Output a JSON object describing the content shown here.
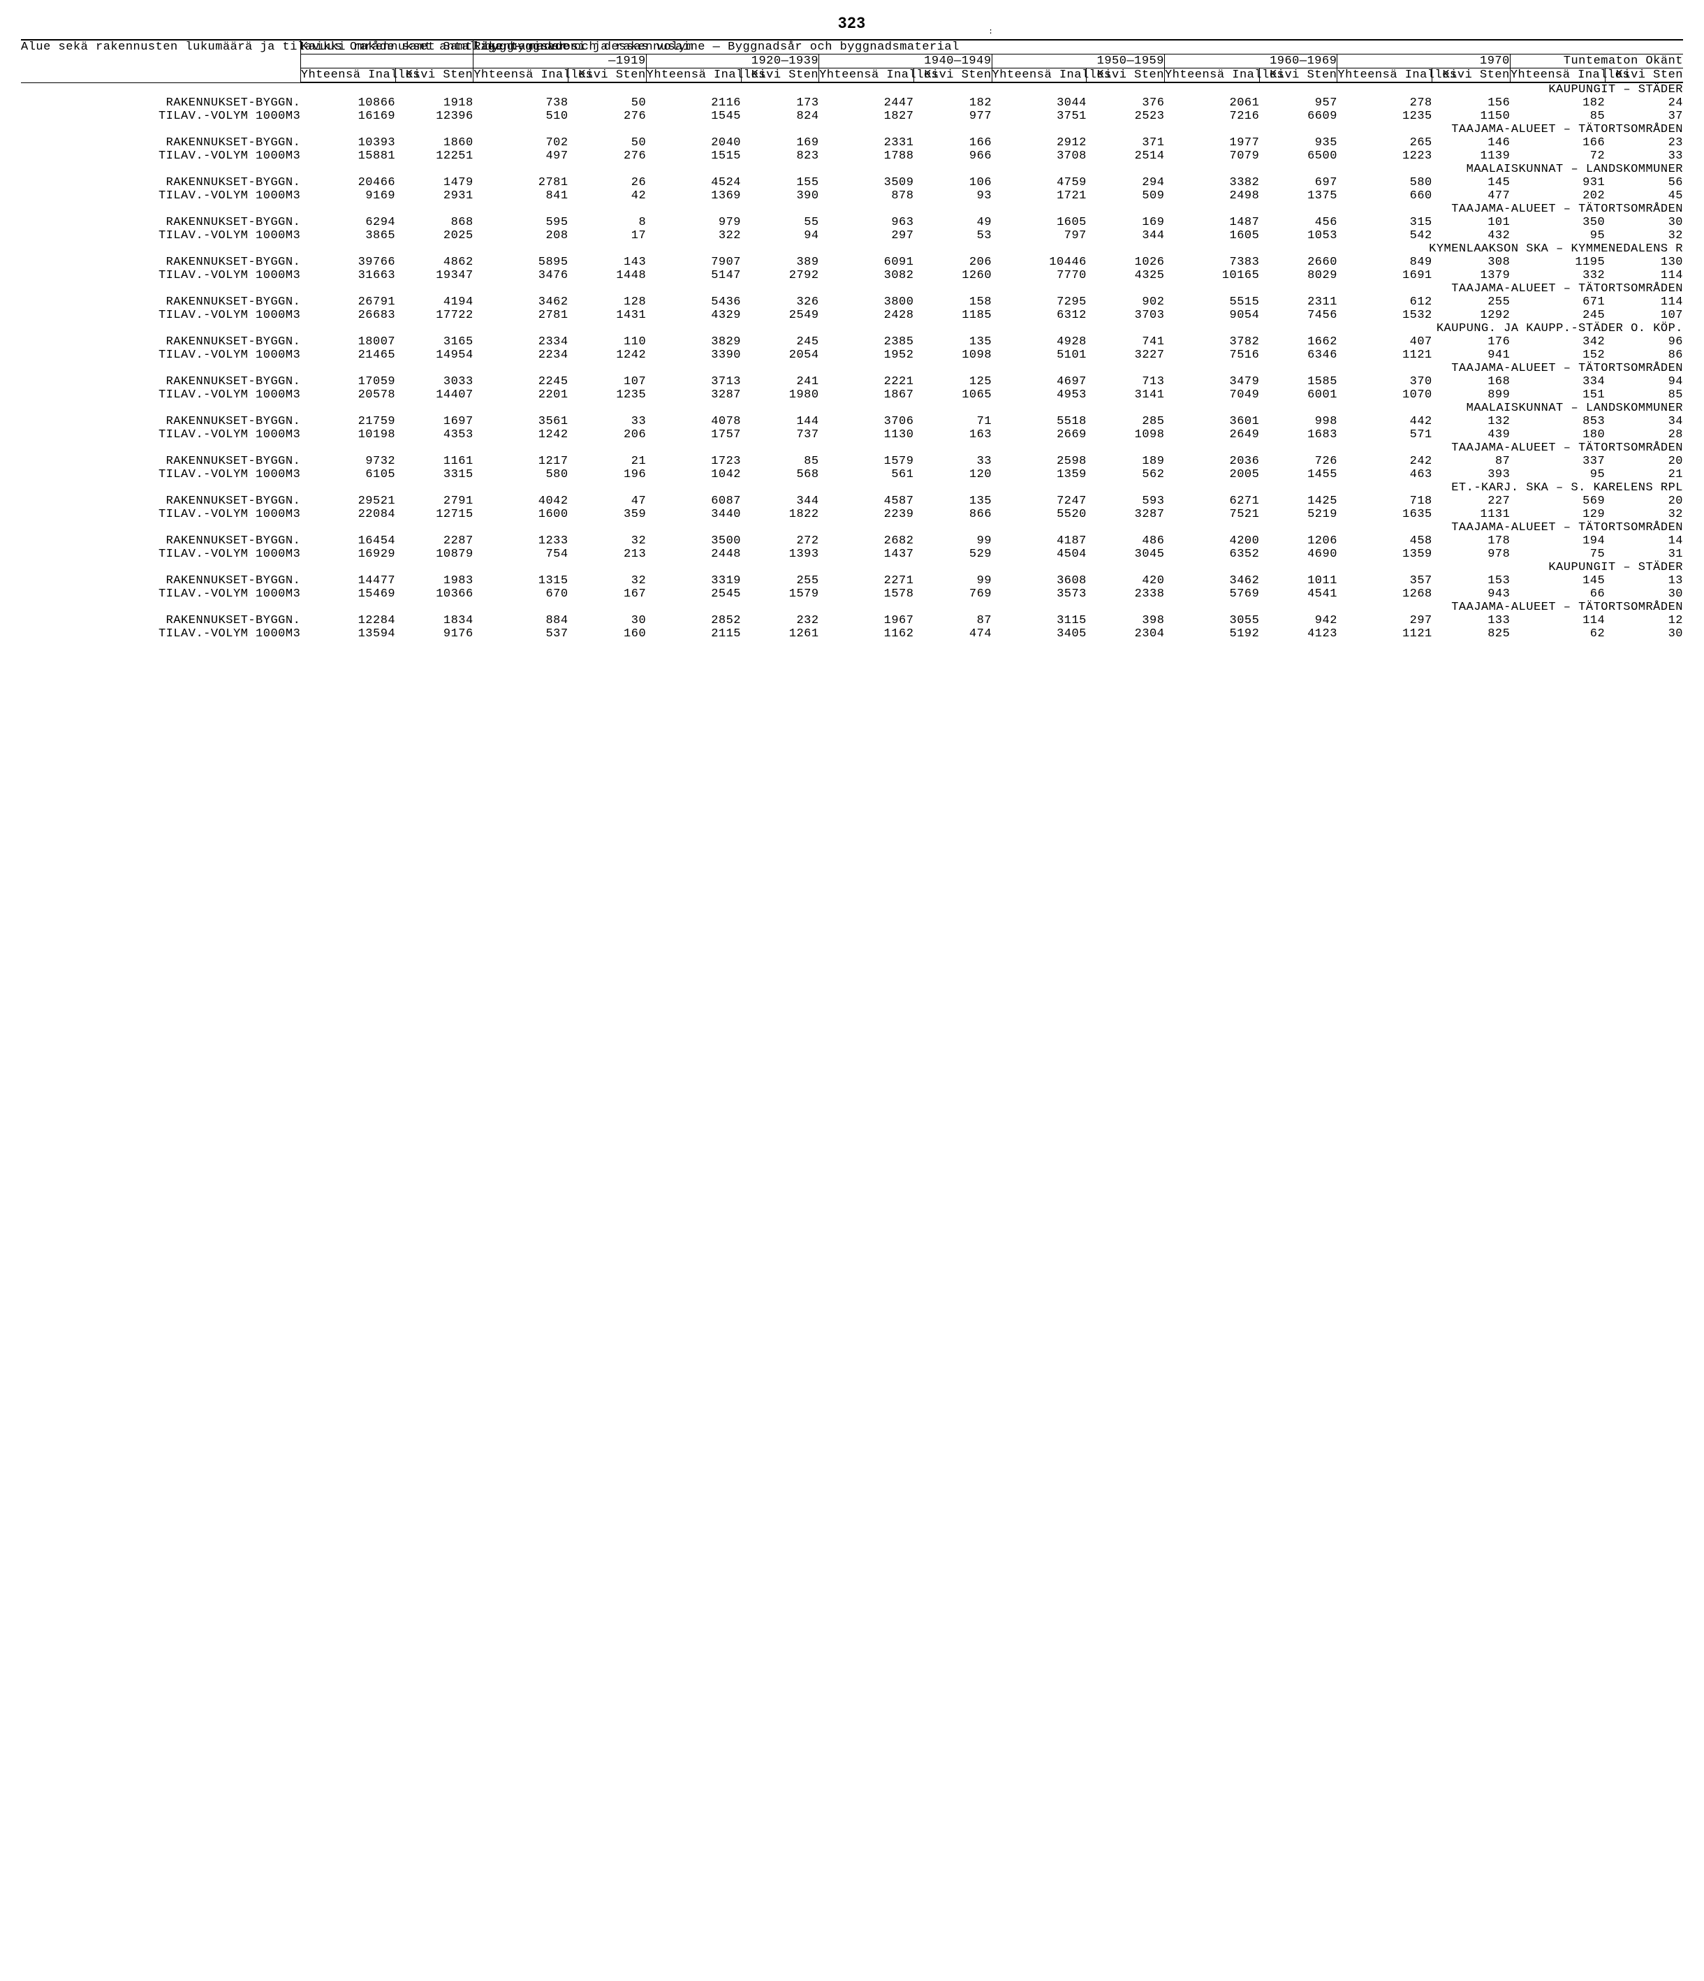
{
  "page_number": "323",
  "odd_mark": ":",
  "header": {
    "area_label": "Alue sekä rakennusten lukumäärä ja tilavuus\nOmråde samt antal bygg-\nnader och dessas volym",
    "all_buildings": "Kaikki\nrakennukset\nSamtliga\nbyggnader",
    "year_material": "Rakentamisvuosi ja rakennusaine — Byggnadsår och byggnadsmaterial",
    "periods": [
      "—1919",
      "1920—1939",
      "1940—1949",
      "1950—1959",
      "1960—1969",
      "1970",
      "Tuntematon\nOkänt"
    ],
    "col_total": "Yhteensä\nInalles",
    "col_stone": "Kivi\nSten"
  },
  "sections": [
    {
      "title": "KAUPUNGIT – STÄDER",
      "rows": [
        {
          "label": "RAKENNUKSET-BYGGN.",
          "v": [
            "10866",
            "1918",
            "738",
            "50",
            "2116",
            "173",
            "2447",
            "182",
            "3044",
            "376",
            "2061",
            "957",
            "278",
            "156",
            "182",
            "24"
          ]
        },
        {
          "label": "TILAV.-VOLYM 1000M3",
          "v": [
            "16169",
            "12396",
            "510",
            "276",
            "1545",
            "824",
            "1827",
            "977",
            "3751",
            "2523",
            "7216",
            "6609",
            "1235",
            "1150",
            "85",
            "37"
          ]
        }
      ]
    },
    {
      "title": "TAAJAMA-ALUEET – TÄTORTSOMRÅDEN",
      "rows": [
        {
          "label": "RAKENNUKSET-BYGGN.",
          "v": [
            "10393",
            "1860",
            "702",
            "50",
            "2040",
            "169",
            "2331",
            "166",
            "2912",
            "371",
            "1977",
            "935",
            "265",
            "146",
            "166",
            "23"
          ]
        },
        {
          "label": "TILAV.-VOLYM 1000M3",
          "v": [
            "15881",
            "12251",
            "497",
            "276",
            "1515",
            "823",
            "1788",
            "966",
            "3708",
            "2514",
            "7079",
            "6500",
            "1223",
            "1139",
            "72",
            "33"
          ]
        }
      ]
    },
    {
      "title": "MAALAISKUNNAT – LANDSKOMMUNER",
      "rows": [
        {
          "label": "RAKENNUKSET-BYGGN.",
          "v": [
            "20466",
            "1479",
            "2781",
            "26",
            "4524",
            "155",
            "3509",
            "106",
            "4759",
            "294",
            "3382",
            "697",
            "580",
            "145",
            "931",
            "56"
          ]
        },
        {
          "label": "TILAV.-VOLYM 1000M3",
          "v": [
            "9169",
            "2931",
            "841",
            "42",
            "1369",
            "390",
            "878",
            "93",
            "1721",
            "509",
            "2498",
            "1375",
            "660",
            "477",
            "202",
            "45"
          ]
        }
      ]
    },
    {
      "title": "TAAJAMA-ALUEET – TÄTORTSOMRÅDEN",
      "rows": [
        {
          "label": "RAKENNUKSET-BYGGN.",
          "v": [
            "6294",
            "868",
            "595",
            "8",
            "979",
            "55",
            "963",
            "49",
            "1605",
            "169",
            "1487",
            "456",
            "315",
            "101",
            "350",
            "30"
          ]
        },
        {
          "label": "TILAV.-VOLYM 1000M3",
          "v": [
            "3865",
            "2025",
            "208",
            "17",
            "322",
            "94",
            "297",
            "53",
            "797",
            "344",
            "1605",
            "1053",
            "542",
            "432",
            "95",
            "32"
          ]
        }
      ]
    },
    {
      "title": "KYMENLAAKSON SKA – KYMMENEDALENS R",
      "rows": [
        {
          "label": "RAKENNUKSET-BYGGN.",
          "v": [
            "39766",
            "4862",
            "5895",
            "143",
            "7907",
            "389",
            "6091",
            "206",
            "10446",
            "1026",
            "7383",
            "2660",
            "849",
            "308",
            "1195",
            "130"
          ]
        },
        {
          "label": "TILAV.-VOLYM 1000M3",
          "v": [
            "31663",
            "19347",
            "3476",
            "1448",
            "5147",
            "2792",
            "3082",
            "1260",
            "7770",
            "4325",
            "10165",
            "8029",
            "1691",
            "1379",
            "332",
            "114"
          ]
        }
      ]
    },
    {
      "title": "TAAJAMA-ALUEET – TÄTORTSOMRÅDEN",
      "rows": [
        {
          "label": "RAKENNUKSET-BYGGN.",
          "v": [
            "26791",
            "4194",
            "3462",
            "128",
            "5436",
            "326",
            "3800",
            "158",
            "7295",
            "902",
            "5515",
            "2311",
            "612",
            "255",
            "671",
            "114"
          ]
        },
        {
          "label": "TILAV.-VOLYM 1000M3",
          "v": [
            "26683",
            "17722",
            "2781",
            "1431",
            "4329",
            "2549",
            "2428",
            "1185",
            "6312",
            "3703",
            "9054",
            "7456",
            "1532",
            "1292",
            "245",
            "107"
          ]
        }
      ]
    },
    {
      "title": "KAUPUNG. JA KAUPP.-STÄDER O. KÖP.",
      "rows": [
        {
          "label": "RAKENNUKSET-BYGGN.",
          "v": [
            "18007",
            "3165",
            "2334",
            "110",
            "3829",
            "245",
            "2385",
            "135",
            "4928",
            "741",
            "3782",
            "1662",
            "407",
            "176",
            "342",
            "96"
          ]
        },
        {
          "label": "TILAV.-VOLYM 1000M3",
          "v": [
            "21465",
            "14954",
            "2234",
            "1242",
            "3390",
            "2054",
            "1952",
            "1098",
            "5101",
            "3227",
            "7516",
            "6346",
            "1121",
            "941",
            "152",
            "86"
          ]
        }
      ]
    },
    {
      "title": "TAAJAMA-ALUEET – TÄTORTSOMRÅDEN",
      "rows": [
        {
          "label": "RAKENNUKSET-BYGGN.",
          "v": [
            "17059",
            "3033",
            "2245",
            "107",
            "3713",
            "241",
            "2221",
            "125",
            "4697",
            "713",
            "3479",
            "1585",
            "370",
            "168",
            "334",
            "94"
          ]
        },
        {
          "label": "TILAV.-VOLYM 1000M3",
          "v": [
            "20578",
            "14407",
            "2201",
            "1235",
            "3287",
            "1980",
            "1867",
            "1065",
            "4953",
            "3141",
            "7049",
            "6001",
            "1070",
            "899",
            "151",
            "85"
          ]
        }
      ]
    },
    {
      "title": "MAALAISKUNNAT – LANDSKOMMUNER",
      "rows": [
        {
          "label": "RAKENNUKSET-BYGGN.",
          "v": [
            "21759",
            "1697",
            "3561",
            "33",
            "4078",
            "144",
            "3706",
            "71",
            "5518",
            "285",
            "3601",
            "998",
            "442",
            "132",
            "853",
            "34"
          ]
        },
        {
          "label": "TILAV.-VOLYM 1000M3",
          "v": [
            "10198",
            "4353",
            "1242",
            "206",
            "1757",
            "737",
            "1130",
            "163",
            "2669",
            "1098",
            "2649",
            "1683",
            "571",
            "439",
            "180",
            "28"
          ]
        }
      ]
    },
    {
      "title": "TAAJAMA-ALUEET – TÄTORTSOMRÅDEN",
      "rows": [
        {
          "label": "RAKENNUKSET-BYGGN.",
          "v": [
            "9732",
            "1161",
            "1217",
            "21",
            "1723",
            "85",
            "1579",
            "33",
            "2598",
            "189",
            "2036",
            "726",
            "242",
            "87",
            "337",
            "20"
          ]
        },
        {
          "label": "TILAV.-VOLYM 1000M3",
          "v": [
            "6105",
            "3315",
            "580",
            "196",
            "1042",
            "568",
            "561",
            "120",
            "1359",
            "562",
            "2005",
            "1455",
            "463",
            "393",
            "95",
            "21"
          ]
        }
      ]
    },
    {
      "title": "ET.-KARJ. SKA – S. KARELENS RPL",
      "rows": [
        {
          "label": "RAKENNUKSET-BYGGN.",
          "v": [
            "29521",
            "2791",
            "4042",
            "47",
            "6087",
            "344",
            "4587",
            "135",
            "7247",
            "593",
            "6271",
            "1425",
            "718",
            "227",
            "569",
            "20"
          ]
        },
        {
          "label": "TILAV.-VOLYM 1000M3",
          "v": [
            "22084",
            "12715",
            "1600",
            "359",
            "3440",
            "1822",
            "2239",
            "866",
            "5520",
            "3287",
            "7521",
            "5219",
            "1635",
            "1131",
            "129",
            "32"
          ]
        }
      ]
    },
    {
      "title": "TAAJAMA-ALUEET – TÄTORTSOMRÅDEN",
      "rows": [
        {
          "label": "RAKENNUKSET-BYGGN.",
          "v": [
            "16454",
            "2287",
            "1233",
            "32",
            "3500",
            "272",
            "2682",
            "99",
            "4187",
            "486",
            "4200",
            "1206",
            "458",
            "178",
            "194",
            "14"
          ]
        },
        {
          "label": "TILAV.-VOLYM 1000M3",
          "v": [
            "16929",
            "10879",
            "754",
            "213",
            "2448",
            "1393",
            "1437",
            "529",
            "4504",
            "3045",
            "6352",
            "4690",
            "1359",
            "978",
            "75",
            "31"
          ]
        }
      ]
    },
    {
      "title": "KAUPUNGIT – STÄDER",
      "rows": [
        {
          "label": "RAKENNUKSET-BYGGN.",
          "v": [
            "14477",
            "1983",
            "1315",
            "32",
            "3319",
            "255",
            "2271",
            "99",
            "3608",
            "420",
            "3462",
            "1011",
            "357",
            "153",
            "145",
            "13"
          ]
        },
        {
          "label": "TILAV.-VOLYM 1000M3",
          "v": [
            "15469",
            "10366",
            "670",
            "167",
            "2545",
            "1579",
            "1578",
            "769",
            "3573",
            "2338",
            "5769",
            "4541",
            "1268",
            "943",
            "66",
            "30"
          ]
        }
      ]
    },
    {
      "title": "TAAJAMA-ALUEET – TÄTORTSOMRÅDEN",
      "rows": [
        {
          "label": "RAKENNUKSET-BYGGN.",
          "v": [
            "12284",
            "1834",
            "884",
            "30",
            "2852",
            "232",
            "1967",
            "87",
            "3115",
            "398",
            "3055",
            "942",
            "297",
            "133",
            "114",
            "12"
          ]
        },
        {
          "label": "TILAV.-VOLYM 1000M3",
          "v": [
            "13594",
            "9176",
            "537",
            "160",
            "2115",
            "1261",
            "1162",
            "474",
            "3405",
            "2304",
            "5192",
            "4123",
            "1121",
            "825",
            "62",
            "30"
          ]
        }
      ]
    }
  ]
}
